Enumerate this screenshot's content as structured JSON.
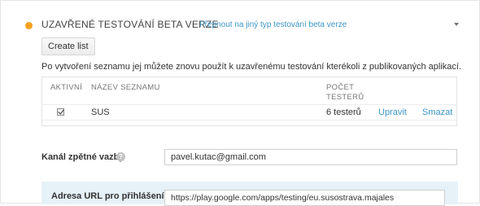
{
  "section": {
    "title": "UZAVŘENÉ TESTOVÁNÍ BETA VERZE",
    "switch_link": "Přepnout na jiný typ testování beta verze",
    "status_color": "#f7a021"
  },
  "create_list_label": "Create list",
  "description": "Po vytvoření seznamu jej můžete znovu použít k uzavřenému testování kterékoli z publikovaných aplikací.",
  "table": {
    "headers": {
      "active": "AKTIVNÍ",
      "name": "NÁZEV SEZNAMU",
      "count": "POČET TESTERŮ"
    },
    "rows": [
      {
        "active": true,
        "name": "SUS",
        "count": "6 testerů",
        "edit": "Upravit",
        "delete": "Smazat"
      }
    ]
  },
  "feedback": {
    "label": "Kanál zpětné vazby",
    "help_icon": "help-icon",
    "value": "pavel.kutac@gmail.com"
  },
  "opt_in": {
    "label": "Adresa URL pro přihlášení",
    "value": "https://play.google.com/apps/testing/eu.susostrava.majales"
  },
  "accent_color": "#3c96c8"
}
